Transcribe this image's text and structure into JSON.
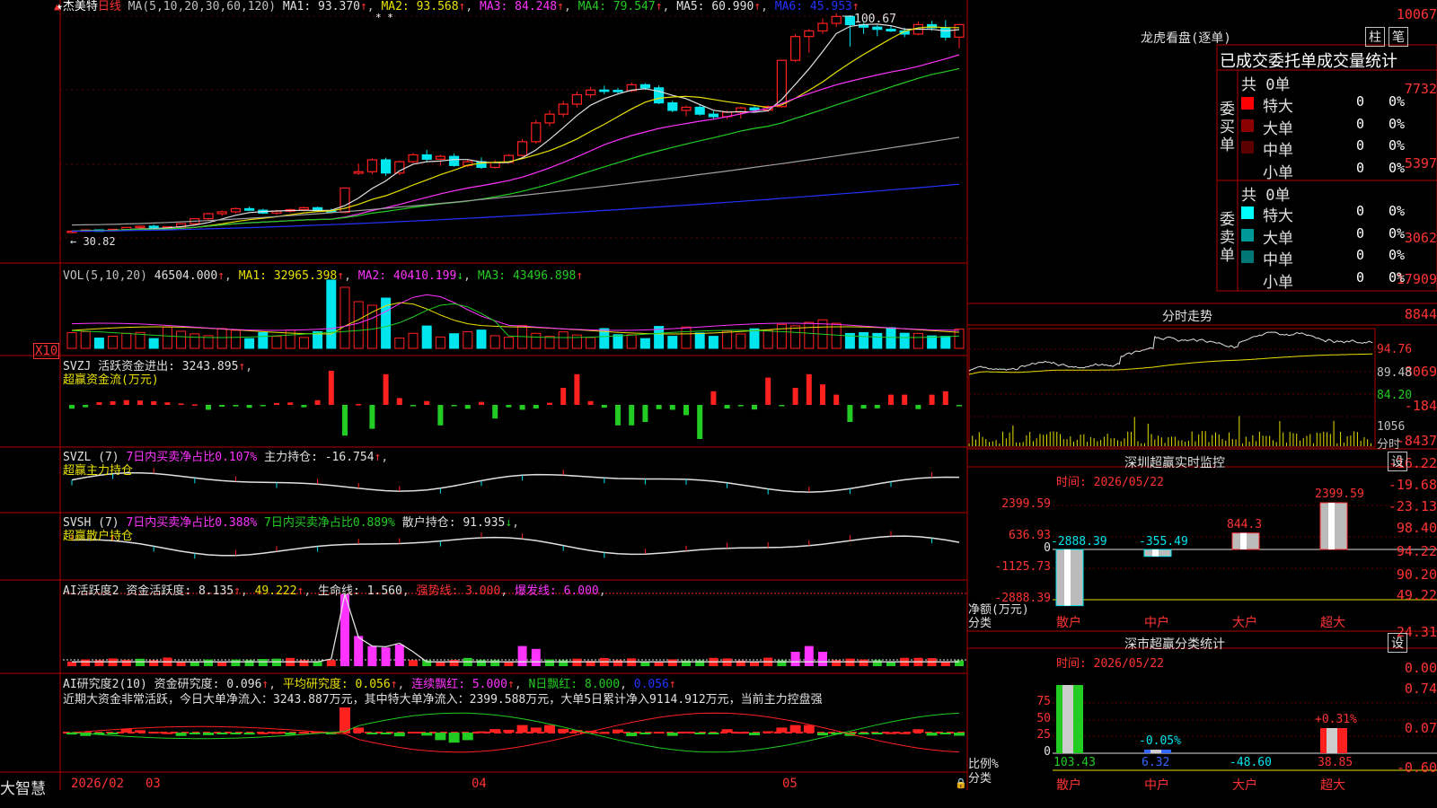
{
  "colors": {
    "up": "#ff2020",
    "down": "#00e5ee",
    "ma1": "#e0e0e0",
    "ma2": "#e8e000",
    "ma3": "#ff33ff",
    "ma4": "#22cc22",
    "ma5": "#a0a0a0",
    "ma6": "#2233ff",
    "grid": "#b00000",
    "label": "#ff3333",
    "panel_border": "#b00000"
  },
  "header": {
    "stock": "★杰美特",
    "period": "日线",
    "ma_title": "MA(5,10,20,30,60,120)",
    "ma1": "MA1: 93.370",
    "ma2": "MA2: 93.568",
    "ma3": "MA3: 84.248",
    "ma4": "MA4: 79.547",
    "ma5": "MA5: 60.990",
    "ma6": "MA6: 45.953",
    "marks": "* *",
    "up_arrow": "↑",
    "down_arrow": "↓",
    "comma": ","
  },
  "price_axis": [
    "10067",
    "7732",
    "5397",
    "3062"
  ],
  "price_annotations": {
    "high": "100.67",
    "low": "30.82"
  },
  "vol_panel": {
    "title": "VOL(5,10,20)",
    "value": "46504.000",
    "ma1": "MA1: 32965.398",
    "ma2": "MA2: 40410.199",
    "ma3": "MA3: 43496.898",
    "axis": [
      "17909",
      "8844"
    ],
    "unit": "X10"
  },
  "svzj_panel": {
    "title": "SVZJ  活跃资金进出: 3243.895",
    "sub": "超赢资金流(万元)",
    "axis": [
      "8069",
      "-184",
      "-8437"
    ]
  },
  "svzl_panel": {
    "title": "SVZL (7)",
    "t1": "7日内买卖净占比0.107%",
    "t2": "主力持仓: -16.754",
    "sub": "超赢主力持仓",
    "axis": [
      "-16.22",
      "-19.68",
      "-23.13"
    ]
  },
  "svsh_panel": {
    "title": "SVSH (7)",
    "t1": "7日内买卖净占比0.388%",
    "t2": "7日内买卖净占比0.889%",
    "t3": "散户持仓: 91.935",
    "sub": "超赢散户持仓",
    "axis": [
      "98.40",
      "94.22",
      "90.20"
    ]
  },
  "ai1_panel": {
    "title": "AI活跃度2",
    "t1": "资金活跃度: 8.135",
    "t2": "49.222",
    "t3": "生命线: 1.560",
    "t4": "强势线: 3.000",
    "t5": "爆发线: 6.000",
    "axis": [
      "49.22",
      "24.31",
      "0.00"
    ]
  },
  "ai2_panel": {
    "title": "AI研究度2(10)",
    "t1": "资金研究度: 0.096",
    "t2": "平均研究度: 0.056",
    "t3": "连续飘红: 5.000",
    "t4": "N日飘红: 8.000",
    "t5": "0.056",
    "comment": "近期大资金非常活跃，今日大单净流入：3243.887万元，其中特大单净流入：2399.588万元，大单5日累计净入9114.912万元，当前主力控盘强",
    "axis": [
      "0.74",
      "0.07",
      "-0.60"
    ]
  },
  "date_axis": {
    "brand": "大智慧",
    "labels": [
      "2026/02",
      "03",
      "04",
      "05"
    ]
  },
  "dragon": {
    "title": "龙虎看盘(逐单)",
    "btn1": "柱",
    "btn2": "笔",
    "head": "已成交委托单成交量统计",
    "buy": {
      "label": "委买单",
      "total": "共 0单",
      "rows": [
        {
          "name": "特大",
          "count": "0",
          "pct": "0%",
          "color": "#ff0000"
        },
        {
          "name": "大单",
          "count": "0",
          "pct": "0%",
          "color": "#8b0000"
        },
        {
          "name": "中单",
          "count": "0",
          "pct": "0%",
          "color": "#5a0000"
        },
        {
          "name": "小单",
          "count": "0",
          "pct": "0%",
          "color": "#000000"
        }
      ]
    },
    "sell": {
      "label": "委卖单",
      "total": "共 0单",
      "rows": [
        {
          "name": "特大",
          "count": "0",
          "pct": "0%",
          "color": "#00ffff"
        },
        {
          "name": "大单",
          "count": "0",
          "pct": "0%",
          "color": "#009999"
        },
        {
          "name": "中单",
          "count": "0",
          "pct": "0%",
          "color": "#007777"
        },
        {
          "name": "小单",
          "count": "0",
          "pct": "0%",
          "color": "#000000"
        }
      ]
    }
  },
  "intraday": {
    "title": "分时走势",
    "axis": [
      "94.76",
      "89.48",
      "84.20"
    ],
    "vol_axis": "1056",
    "vol_label": "分时"
  },
  "monitor": {
    "title": "深圳超赢实时监控",
    "btn": "设",
    "time": "时间: 2026/05/22",
    "axis": [
      "2399.59",
      "636.93",
      "0",
      "-1125.73",
      "-2888.39"
    ],
    "ylabel": "净额(万元)",
    "xlabel": "分类",
    "categories": [
      "散户",
      "中户",
      "大户",
      "超大"
    ],
    "values": [
      -2888.39,
      -355.49,
      844.3,
      2399.59
    ],
    "value_labels": [
      "-2888.39",
      "-355.49",
      "844.3",
      "2399.59"
    ]
  },
  "classify": {
    "title": "深市超赢分类统计",
    "btn": "设",
    "time": "时间: 2026/05/22",
    "axis": [
      "75",
      "50",
      "25",
      "0"
    ],
    "ylabel": "比例%",
    "xlabel": "分类",
    "categories": [
      "散户",
      "中户",
      "大户",
      "超大"
    ],
    "values": [
      103.43,
      6.32,
      -48.6,
      38.85
    ],
    "value_labels": [
      "103.43",
      "6.32",
      "-48.60",
      "38.85"
    ],
    "bar_labels": [
      "",
      "-0.05%",
      "",
      "+0.31%"
    ]
  },
  "chart_data": {
    "type": "bar",
    "candles": [
      [
        30.8,
        31.2,
        30.4,
        31.0
      ],
      [
        31.0,
        31.6,
        30.8,
        31.4
      ],
      [
        31.4,
        31.6,
        30.9,
        31.1
      ],
      [
        31.1,
        31.8,
        31.0,
        31.6
      ],
      [
        31.5,
        32.4,
        31.3,
        32.2
      ],
      [
        32.2,
        32.9,
        31.9,
        32.6
      ],
      [
        32.6,
        33.2,
        31.4,
        31.6
      ],
      [
        31.6,
        32.6,
        31.3,
        32.4
      ],
      [
        32.4,
        33.6,
        32.2,
        33.4
      ],
      [
        33.4,
        35.2,
        33.2,
        35.0
      ],
      [
        35.0,
        36.9,
        34.4,
        36.6
      ],
      [
        36.6,
        37.6,
        35.9,
        37.2
      ],
      [
        37.2,
        38.6,
        36.7,
        38.2
      ],
      [
        38.2,
        38.9,
        37.4,
        37.7
      ],
      [
        37.7,
        38.2,
        36.5,
        36.8
      ],
      [
        36.8,
        37.9,
        36.2,
        37.4
      ],
      [
        37.4,
        38.2,
        36.9,
        37.9
      ],
      [
        37.9,
        38.9,
        37.4,
        38.5
      ],
      [
        38.5,
        38.9,
        37.4,
        37.6
      ],
      [
        37.6,
        38.2,
        36.8,
        37.1
      ],
      [
        37.0,
        45.0,
        36.8,
        44.8
      ],
      [
        49.5,
        52.6,
        49.0,
        50.0
      ],
      [
        50.0,
        54.3,
        49.2,
        53.8
      ],
      [
        53.8,
        54.5,
        48.6,
        49.6
      ],
      [
        49.6,
        53.6,
        48.9,
        53.2
      ],
      [
        53.2,
        56.0,
        52.7,
        55.4
      ],
      [
        55.4,
        57.0,
        53.0,
        54.0
      ],
      [
        54.0,
        55.5,
        51.9,
        54.9
      ],
      [
        54.9,
        55.8,
        51.6,
        52.0
      ],
      [
        52.0,
        53.8,
        51.5,
        53.2
      ],
      [
        53.2,
        54.6,
        50.9,
        51.4
      ],
      [
        51.4,
        53.7,
        51.0,
        53.0
      ],
      [
        53.0,
        55.6,
        52.8,
        55.2
      ],
      [
        55.2,
        60.4,
        54.9,
        59.6
      ],
      [
        59.6,
        66.6,
        59.0,
        65.6
      ],
      [
        65.6,
        69.6,
        64.5,
        68.4
      ],
      [
        68.4,
        72.6,
        67.4,
        71.6
      ],
      [
        71.6,
        75.6,
        70.5,
        74.6
      ],
      [
        74.6,
        77.1,
        73.6,
        76.1
      ],
      [
        76.1,
        77.5,
        74.8,
        76.0
      ],
      [
        76.0,
        76.8,
        74.6,
        75.9
      ],
      [
        75.9,
        78.5,
        75.4,
        77.8
      ],
      [
        77.8,
        78.3,
        76.1,
        76.8
      ],
      [
        76.8,
        77.6,
        71.6,
        72.0
      ],
      [
        72.0,
        72.7,
        69.0,
        69.6
      ],
      [
        69.6,
        71.2,
        67.7,
        70.6
      ],
      [
        70.6,
        71.5,
        67.9,
        68.4
      ],
      [
        68.4,
        69.4,
        66.7,
        67.6
      ],
      [
        67.6,
        69.6,
        66.8,
        69.0
      ],
      [
        69.0,
        70.8,
        67.0,
        70.4
      ],
      [
        70.4,
        71.1,
        69.5,
        69.7
      ],
      [
        69.7,
        71.2,
        69.1,
        70.8
      ],
      [
        70.8,
        85.8,
        70.5,
        85.6
      ],
      [
        85.6,
        94.0,
        85.0,
        93.2
      ],
      [
        93.2,
        95.6,
        88.0,
        95.0
      ],
      [
        95.0,
        99.0,
        94.0,
        97.4
      ],
      [
        97.4,
        100.67,
        96.2,
        99.6
      ],
      [
        99.6,
        100.0,
        90.0,
        97.0
      ],
      [
        97.0,
        97.6,
        94.0,
        96.2
      ],
      [
        96.2,
        96.8,
        93.3,
        95.5
      ],
      [
        95.5,
        96.8,
        94.6,
        95.0
      ],
      [
        95.0,
        96.0,
        93.0,
        94.0
      ],
      [
        94.0,
        98.0,
        93.6,
        97.0
      ],
      [
        97.0,
        98.2,
        95.0,
        96.0
      ],
      [
        96.0,
        98.4,
        92.0,
        93.0
      ],
      [
        93.0,
        97.3,
        89.4,
        97.0
      ]
    ]
  }
}
